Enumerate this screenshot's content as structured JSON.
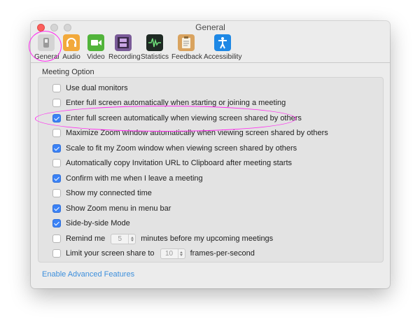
{
  "window": {
    "title": "General"
  },
  "toolbar": {
    "items": [
      {
        "label": "General",
        "icon": "general-gear-icon",
        "color": "#c8c8c8"
      },
      {
        "label": "Audio",
        "icon": "headphones-icon",
        "color": "#f2a93b"
      },
      {
        "label": "Video",
        "icon": "video-camera-icon",
        "color": "#52b43b"
      },
      {
        "label": "Recording",
        "icon": "film-strip-icon",
        "color": "#7a5b98"
      },
      {
        "label": "Statistics",
        "icon": "waveform-icon",
        "color": "#1f2a24"
      },
      {
        "label": "Feedback",
        "icon": "clipboard-icon",
        "color": "#d9a35f"
      },
      {
        "label": "Accessibility",
        "icon": "accessibility-icon",
        "color": "#1e88e5"
      }
    ]
  },
  "section": {
    "title": "Meeting Option"
  },
  "options": [
    {
      "label": "Use dual monitors",
      "checked": false
    },
    {
      "label": "Enter full screen automatically when starting or joining a meeting",
      "checked": false
    },
    {
      "label": "Enter full screen automatically when viewing screen shared by others",
      "checked": true
    },
    {
      "label": "Maximize Zoom window automatically when viewing screen shared by others",
      "checked": false
    },
    {
      "label": "Scale to fit my Zoom window when viewing screen shared by others",
      "checked": true
    },
    {
      "label": "Automatically copy Invitation URL to Clipboard after meeting starts",
      "checked": false
    },
    {
      "label": "Confirm with me when I leave a meeting",
      "checked": true
    },
    {
      "label": "Show my connected time",
      "checked": false
    },
    {
      "label": "Show Zoom menu in menu bar",
      "checked": true
    },
    {
      "label": "Side-by-side Mode",
      "checked": true
    }
  ],
  "remind": {
    "label": "Remind me",
    "value": "5",
    "suffix": "minutes before my upcoming meetings",
    "checked": false
  },
  "share": {
    "label": "Limit your screen share to",
    "value": "10",
    "suffix": "frames-per-second",
    "checked": false
  },
  "link": {
    "label": "Enable Advanced Features"
  },
  "colors": {
    "accent": "#3b82f6",
    "link": "#3d8fdc",
    "annotation": "#ff2cf0"
  }
}
